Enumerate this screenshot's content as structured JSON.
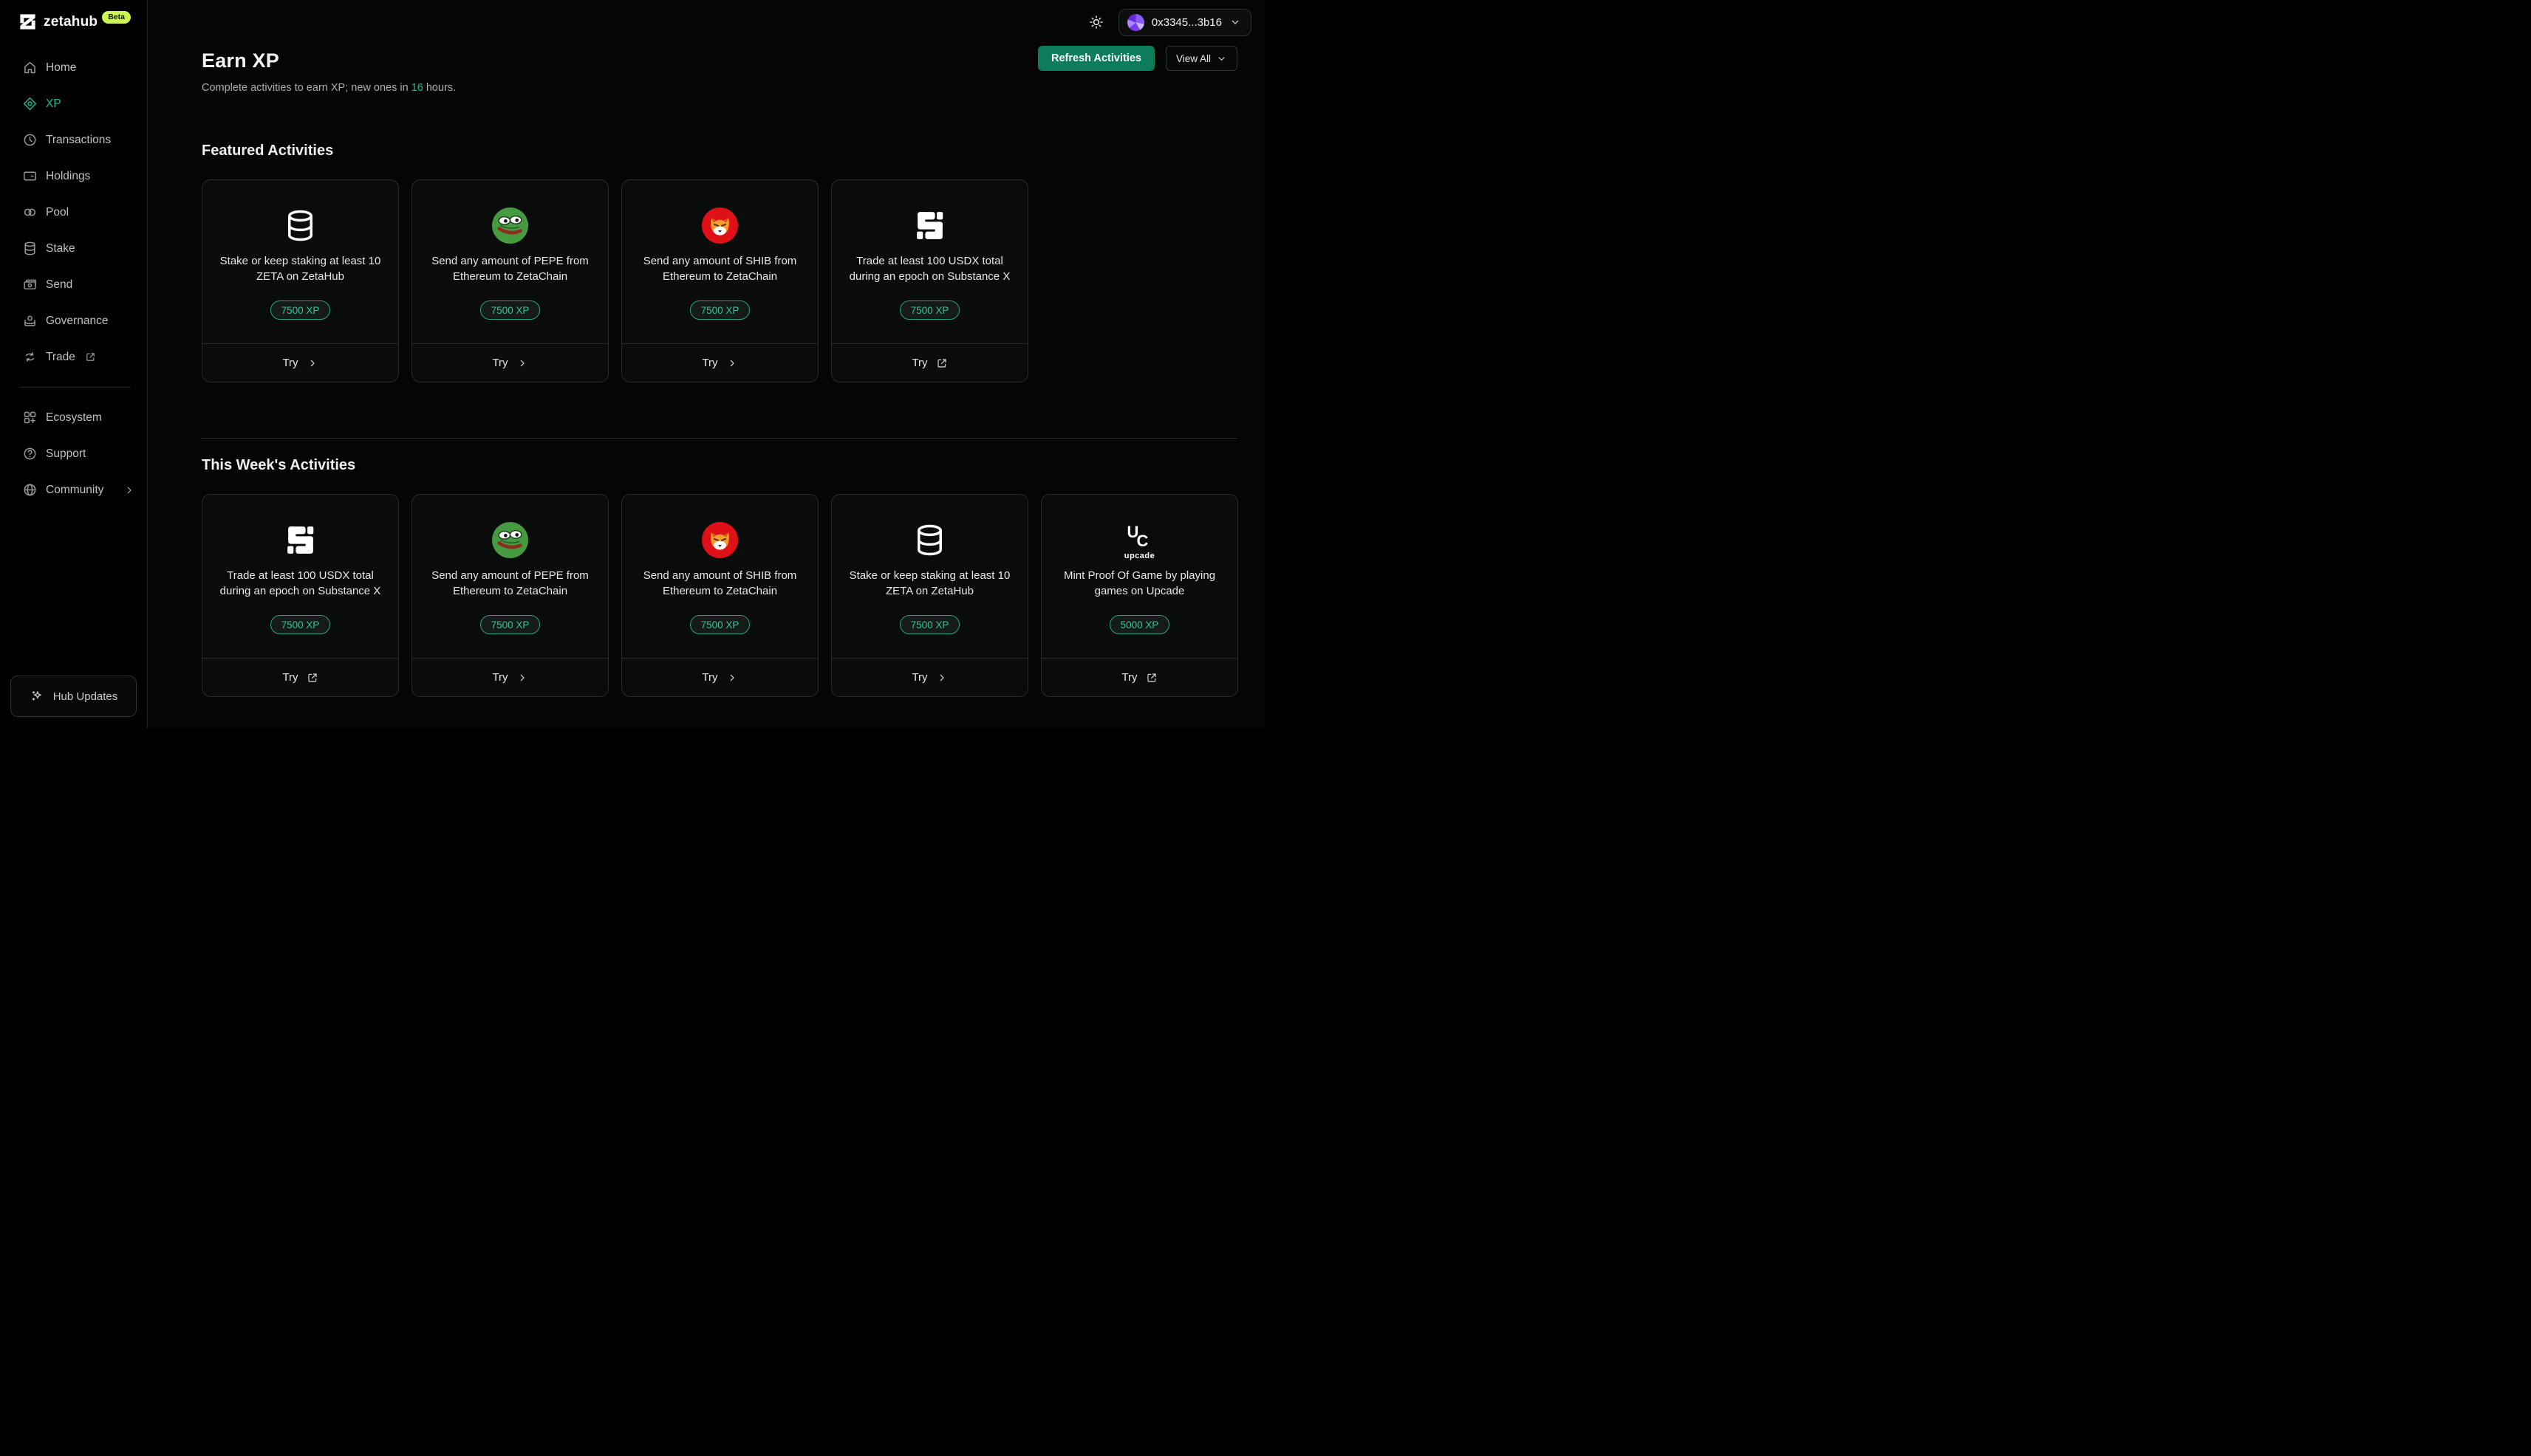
{
  "brand": {
    "name": "zetahub",
    "beta_badge": "Beta"
  },
  "topbar": {
    "wallet_address": "0x3345...3b16"
  },
  "sidebar": {
    "items": [
      {
        "label": "Home",
        "icon": "home-icon",
        "active": false
      },
      {
        "label": "XP",
        "icon": "xp-diamond-icon",
        "active": true
      },
      {
        "label": "Transactions",
        "icon": "clock-icon",
        "active": false
      },
      {
        "label": "Holdings",
        "icon": "wallet-card-icon",
        "active": false
      },
      {
        "label": "Pool",
        "icon": "pool-circles-icon",
        "active": false
      },
      {
        "label": "Stake",
        "icon": "coin-stack-icon",
        "active": false
      },
      {
        "label": "Send",
        "icon": "banknote-icon",
        "active": false
      },
      {
        "label": "Governance",
        "icon": "governance-icon",
        "active": false
      },
      {
        "label": "Trade",
        "icon": "swap-arrows-icon",
        "active": false,
        "external": true
      }
    ],
    "secondary_items": [
      {
        "label": "Ecosystem",
        "icon": "grid-plus-icon"
      },
      {
        "label": "Support",
        "icon": "help-circle-icon"
      },
      {
        "label": "Community",
        "icon": "globe-icon",
        "chevron": true
      }
    ],
    "hub_updates_label": "Hub Updates"
  },
  "page": {
    "title": "Earn XP",
    "subtitle_prefix": "Complete activities to earn XP; new ones in ",
    "subtitle_highlight": "16",
    "subtitle_suffix": " hours.",
    "refresh_button_label": "Refresh Activities",
    "view_all_label": "View All",
    "try_label": "Try"
  },
  "sections": [
    {
      "title": "Featured Activities",
      "cards": [
        {
          "icon": "coin-stack-icon",
          "title": "Stake or keep staking at least 10 ZETA on ZetaHub",
          "xp": "7500 XP",
          "action_icon": "chevron-right-icon"
        },
        {
          "icon": "pepe-token-icon",
          "title": "Send any amount of PEPE from Ethereum to ZetaChain",
          "xp": "7500 XP",
          "action_icon": "chevron-right-icon"
        },
        {
          "icon": "shib-token-icon",
          "title": "Send any amount of SHIB from Ethereum to ZetaChain",
          "xp": "7500 XP",
          "action_icon": "chevron-right-icon"
        },
        {
          "icon": "substance-x-icon",
          "title": "Trade at least 100 USDX total during an epoch on Substance X",
          "xp": "7500 XP",
          "action_icon": "external-link-icon"
        }
      ]
    },
    {
      "title": "This Week's Activities",
      "cards": [
        {
          "icon": "substance-x-icon",
          "title": "Trade at least 100 USDX total during an epoch on Substance X",
          "xp": "7500 XP",
          "action_icon": "external-link-icon"
        },
        {
          "icon": "pepe-token-icon",
          "title": "Send any amount of PEPE from Ethereum to ZetaChain",
          "xp": "7500 XP",
          "action_icon": "chevron-right-icon"
        },
        {
          "icon": "shib-token-icon",
          "title": "Send any amount of SHIB from Ethereum to ZetaChain",
          "xp": "7500 XP",
          "action_icon": "chevron-right-icon"
        },
        {
          "icon": "coin-stack-icon",
          "title": "Stake or keep staking at least 10 ZETA on ZetaHub",
          "xp": "7500 XP",
          "action_icon": "chevron-right-icon"
        },
        {
          "icon": "upcade-icon",
          "upcade_wordmark": "upcade",
          "title": "Mint Proof Of Game by playing games on Upcade",
          "xp": "5000 XP",
          "action_icon": "external-link-icon"
        }
      ]
    }
  ],
  "colors": {
    "accent_green": "#1db894",
    "button_green": "#0c7c5a",
    "beta_lime": "#cdf652",
    "pepe_green": "#469b41",
    "shib_red": "#e01116"
  }
}
